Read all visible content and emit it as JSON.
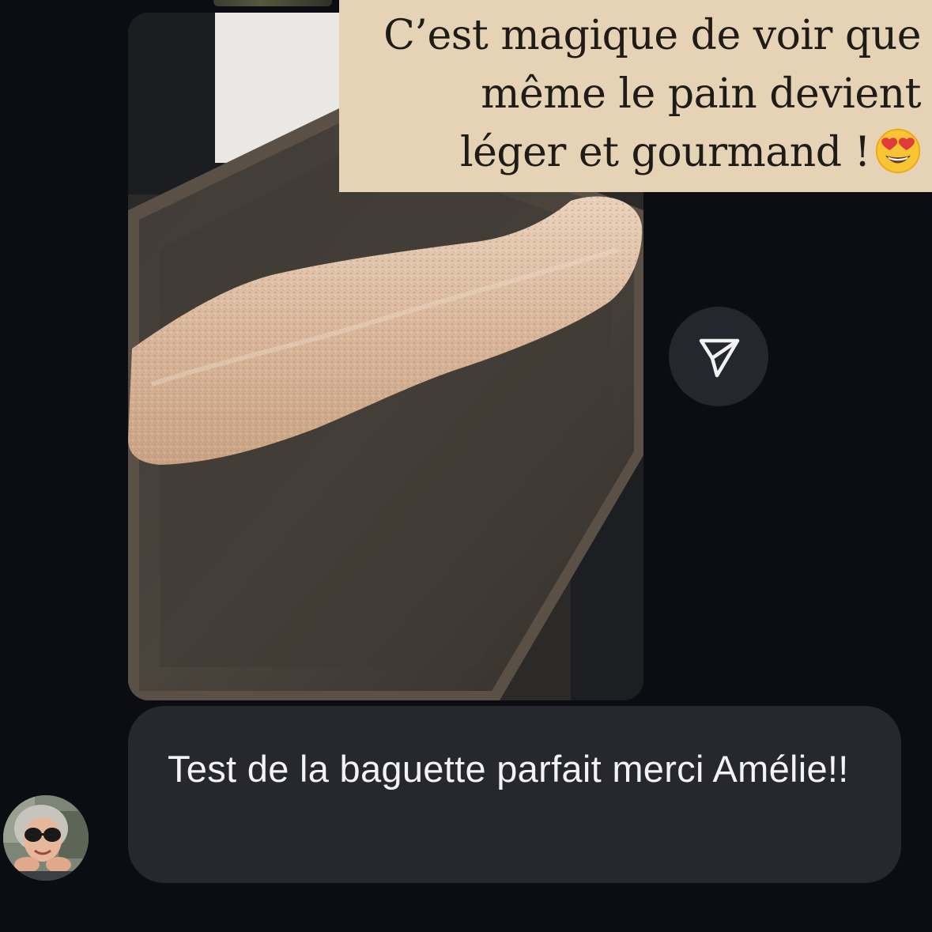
{
  "caption": {
    "line1": "C’est magique de voir que",
    "line2": "même le pain devient",
    "line3": "léger et gourmand !",
    "emoji": "smiling-face-with-heart-eyes"
  },
  "shared_photo": {
    "subject": "baguette on baking tray"
  },
  "share_button": {
    "icon": "paper-plane-icon"
  },
  "message": {
    "text": "Test de la baguette parfait merci Amélie!!"
  },
  "colors": {
    "background": "#0b0d12",
    "bubble": "#26282e",
    "caption_bg": "#e6d3b5",
    "share_button_bg": "#25272e"
  }
}
